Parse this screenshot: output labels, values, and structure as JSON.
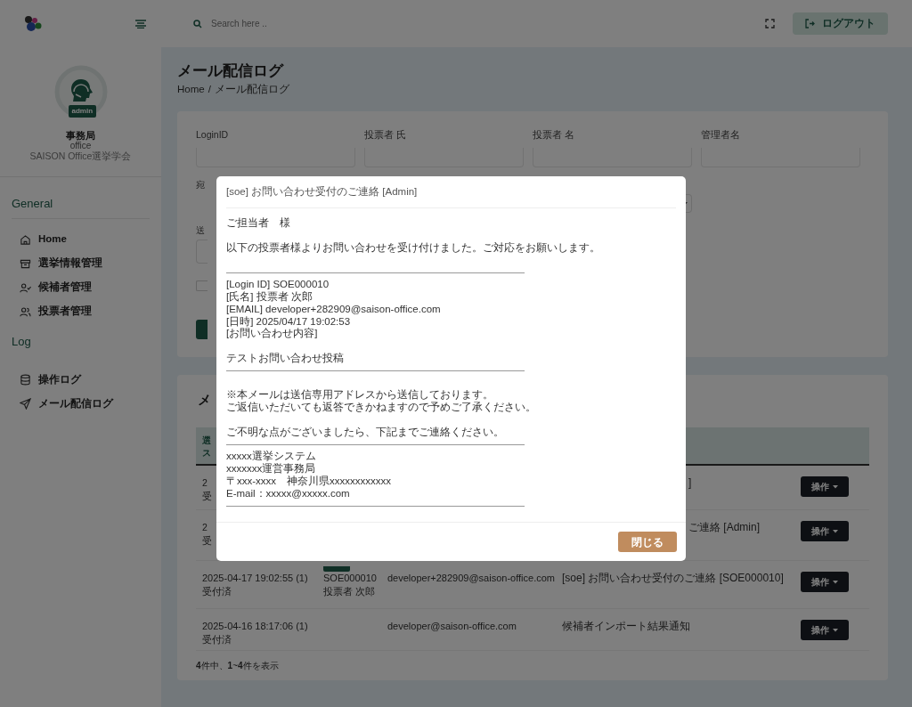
{
  "topbar": {
    "search": {
      "placeholder": "Search here .."
    },
    "logout": "ログアウト"
  },
  "sidebar": {
    "role_badge": "admin",
    "user_name": "事務局",
    "user_id": "office",
    "organization": "SAISON Office選挙学会",
    "sections": [
      {
        "title": "General",
        "items": [
          {
            "label": "Home",
            "kind": "home"
          },
          {
            "label": "選挙情報管理",
            "kind": "archive"
          },
          {
            "label": "候補者管理",
            "kind": "user-check"
          },
          {
            "label": "投票者管理",
            "kind": "users"
          }
        ]
      },
      {
        "title": "Log",
        "items": [
          {
            "label": "操作ログ",
            "kind": "database"
          },
          {
            "label": "メール配信ログ",
            "kind": "send"
          }
        ]
      }
    ]
  },
  "page": {
    "title": "メール配信ログ",
    "breadcrumb": [
      "Home",
      "メール配信ログ"
    ],
    "separator": "/"
  },
  "filter": {
    "fields": [
      {
        "label": "LoginID"
      },
      {
        "label": "投票者 氏"
      },
      {
        "label": "投票者 名"
      },
      {
        "label": "管理者名"
      }
    ],
    "recipient_label": "宛",
    "sent_label": "送",
    "checkbox": {
      "checked": false
    }
  },
  "table": {
    "title": "メ",
    "header": [
      "選",
      "ス"
    ],
    "rows": [
      {
        "kind": "fragment",
        "column_1": [
          "2",
          "受"
        ],
        "column_4": "]",
        "action": "操作"
      },
      {
        "kind": "fragment",
        "column_1": [
          "2",
          "受"
        ],
        "column_4": "ご連絡 [Admin]",
        "action": "操作"
      },
      {
        "kind": "full",
        "column_1": [
          "2025-04-17 19:02:55 (1)",
          "受付済"
        ],
        "badge": true,
        "column_2": [
          "SOE000010",
          "投票者 次郎"
        ],
        "column_3": "developer+282909@saison-office.com",
        "column_4": "[soe] お問い合わせ受付のご連絡 [SOE000010]",
        "action": "操作"
      },
      {
        "kind": "full",
        "column_1": [
          "2025-04-16 18:17:06 (1)",
          "受付済"
        ],
        "badge": false,
        "column_2": [],
        "column_3": "developer@saison-office.com",
        "column_4": "候補者インポート結果通知",
        "action": "操作"
      }
    ],
    "summary": "**4**件中、**1**~**4**件を表示"
  },
  "modal": {
    "title": "[soe] お問い合わせ受付のご連絡 [Admin]",
    "body": [
      {
        "kind": "text",
        "text": "ご担当者　様"
      },
      {
        "kind": "blank"
      },
      {
        "kind": "text",
        "text": "以下の投票者様よりお問い合わせを受け付けました。ご対応をお願いします。"
      },
      {
        "kind": "blank"
      },
      {
        "kind": "rule"
      },
      {
        "kind": "text",
        "text": "[Login ID] SOE000010"
      },
      {
        "kind": "text",
        "text": "[氏名] 投票者 次郎"
      },
      {
        "kind": "text",
        "text": "[EMAIL] developer+282909@saison-office.com"
      },
      {
        "kind": "text",
        "text": "[日時] 2025/04/17 19:02:53"
      },
      {
        "kind": "text",
        "text": "[お問い合わせ内容]"
      },
      {
        "kind": "blank"
      },
      {
        "kind": "text",
        "text": "テストお問い合わせ投稿"
      },
      {
        "kind": "rule"
      },
      {
        "kind": "blank"
      },
      {
        "kind": "text",
        "text": "※本メールは送信専用アドレスから送信しております。"
      },
      {
        "kind": "text",
        "text": "ご返信いただいても返答できかねますので予めご了承ください。"
      },
      {
        "kind": "blank"
      },
      {
        "kind": "text",
        "text": "ご不明な点がございましたら、下記までご連絡ください。"
      },
      {
        "kind": "rule"
      },
      {
        "kind": "text",
        "text": "xxxxx選挙システム"
      },
      {
        "kind": "text",
        "text": "xxxxxxx運営事務局"
      },
      {
        "kind": "text",
        "text": "〒xxx-xxxx　神奈川県xxxxxxxxxxxx"
      },
      {
        "kind": "text",
        "text": "E-mail：xxxxx@xxxxx.com"
      },
      {
        "kind": "rule"
      }
    ],
    "close": "閉じる"
  }
}
